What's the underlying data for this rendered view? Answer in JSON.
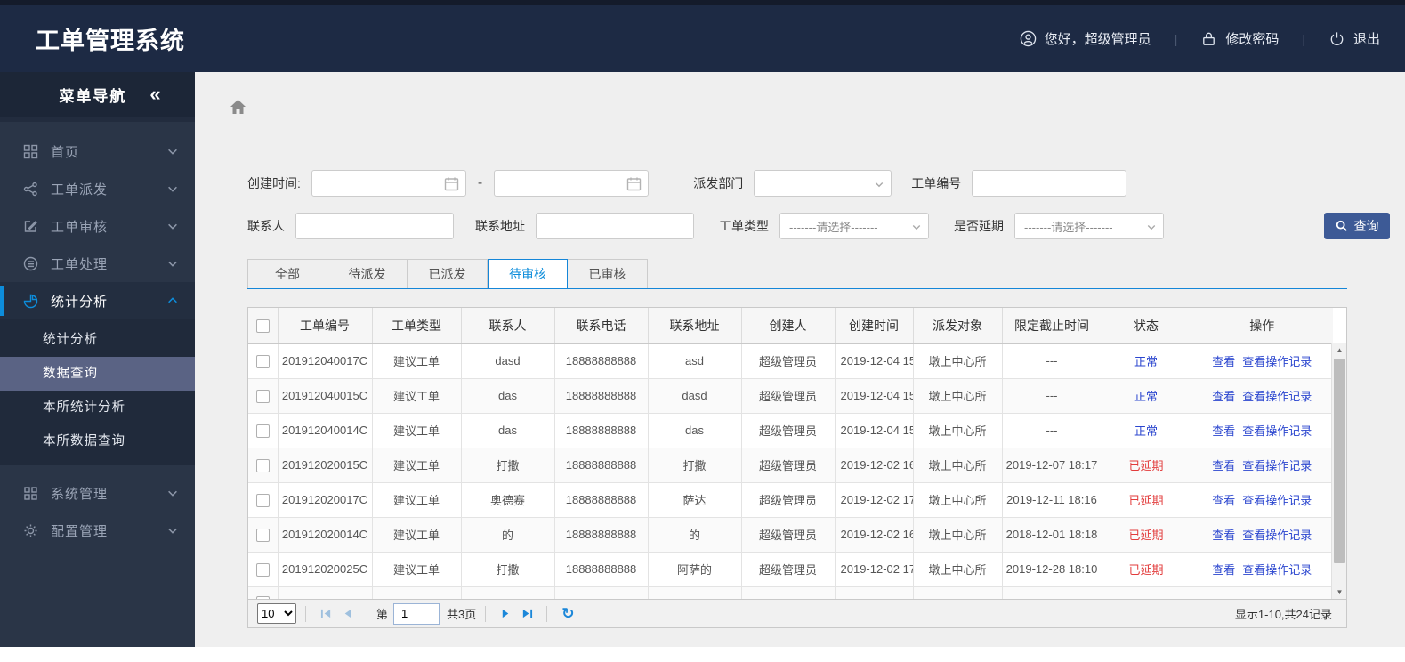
{
  "colors": {
    "accent": "#0d8ddb",
    "link_blue": "#2b46cf",
    "danger_red": "#e23b3b",
    "button_blue": "#3d5a96",
    "header_navy": "#1d2a44"
  },
  "header": {
    "title": "工单管理系统",
    "greeting": "您好，超级管理员",
    "change_password": "修改密码",
    "logout": "退出"
  },
  "sidebar": {
    "title": "菜单导航",
    "collapse_icon": "«",
    "items": [
      {
        "label": "首页"
      },
      {
        "label": "工单派发"
      },
      {
        "label": "工单审核"
      },
      {
        "label": "工单处理"
      },
      {
        "label": "统计分析"
      },
      {
        "label": "系统管理"
      },
      {
        "label": "配置管理"
      }
    ],
    "submenu": [
      {
        "label": "统计分析"
      },
      {
        "label": "数据查询"
      },
      {
        "label": "本所统计分析"
      },
      {
        "label": "本所数据查询"
      }
    ]
  },
  "filters": {
    "create_time_label": "创建时间:",
    "date_from_value": "",
    "date_separator": "-",
    "date_to_value": "",
    "dispatch_dept_label": "派发部门",
    "dispatch_dept_value": "",
    "order_no_label": "工单编号",
    "order_no_value": "",
    "contact_label": "联系人",
    "contact_value": "",
    "address_label": "联系地址",
    "address_value": "",
    "order_type_label": "工单类型",
    "order_type_value": "-------请选择-------",
    "delay_label": "是否延期",
    "delay_value": "-------请选择-------",
    "search_button": "查询"
  },
  "tabs": [
    {
      "label": "全部"
    },
    {
      "label": "待派发"
    },
    {
      "label": "已派发"
    },
    {
      "label": "待审核",
      "active": true
    },
    {
      "label": "已审核"
    }
  ],
  "table": {
    "columns": [
      "工单编号",
      "工单类型",
      "联系人",
      "联系电话",
      "联系地址",
      "创建人",
      "创建时间",
      "派发对象",
      "限定截止时间",
      "状态",
      "操作"
    ],
    "action_labels": [
      "查看",
      "查看操作记录"
    ],
    "rows": [
      {
        "order_no": "201912040017C",
        "type": "建议工单",
        "contact": "dasd",
        "phone": "18888888888",
        "address": "asd",
        "creator": "超级管理员",
        "created": "2019-12-04 15",
        "target": "墩上中心所",
        "deadline": "---",
        "status": "正常",
        "status_type": "normal"
      },
      {
        "order_no": "201912040015C",
        "type": "建议工单",
        "contact": "das",
        "phone": "18888888888",
        "address": "dasd",
        "creator": "超级管理员",
        "created": "2019-12-04 15",
        "target": "墩上中心所",
        "deadline": "---",
        "status": "正常",
        "status_type": "normal"
      },
      {
        "order_no": "201912040014C",
        "type": "建议工单",
        "contact": "das",
        "phone": "18888888888",
        "address": "das",
        "creator": "超级管理员",
        "created": "2019-12-04 15",
        "target": "墩上中心所",
        "deadline": "---",
        "status": "正常",
        "status_type": "normal"
      },
      {
        "order_no": "201912020015C",
        "type": "建议工单",
        "contact": "打撒",
        "phone": "18888888888",
        "address": "打撒",
        "creator": "超级管理员",
        "created": "2019-12-02 16",
        "target": "墩上中心所",
        "deadline": "2019-12-07 18:17",
        "status": "已延期",
        "status_type": "delayed"
      },
      {
        "order_no": "201912020017C",
        "type": "建议工单",
        "contact": "奥德赛",
        "phone": "18888888888",
        "address": "萨达",
        "creator": "超级管理员",
        "created": "2019-12-02 17",
        "target": "墩上中心所",
        "deadline": "2019-12-11 18:16",
        "status": "已延期",
        "status_type": "delayed"
      },
      {
        "order_no": "201912020014C",
        "type": "建议工单",
        "contact": "的",
        "phone": "18888888888",
        "address": "的",
        "creator": "超级管理员",
        "created": "2019-12-02 16",
        "target": "墩上中心所",
        "deadline": "2018-12-01 18:18",
        "status": "已延期",
        "status_type": "delayed"
      },
      {
        "order_no": "201912020025C",
        "type": "建议工单",
        "contact": "打撒",
        "phone": "18888888888",
        "address": "阿萨的",
        "creator": "超级管理员",
        "created": "2019-12-02 17",
        "target": "墩上中心所",
        "deadline": "2019-12-28 18:10",
        "status": "已延期",
        "status_type": "delayed"
      }
    ]
  },
  "pagination": {
    "page_size": "10",
    "page_prefix": "第",
    "current_page": "1",
    "total_pages": "共3页",
    "summary": "显示1-10,共24记录"
  }
}
